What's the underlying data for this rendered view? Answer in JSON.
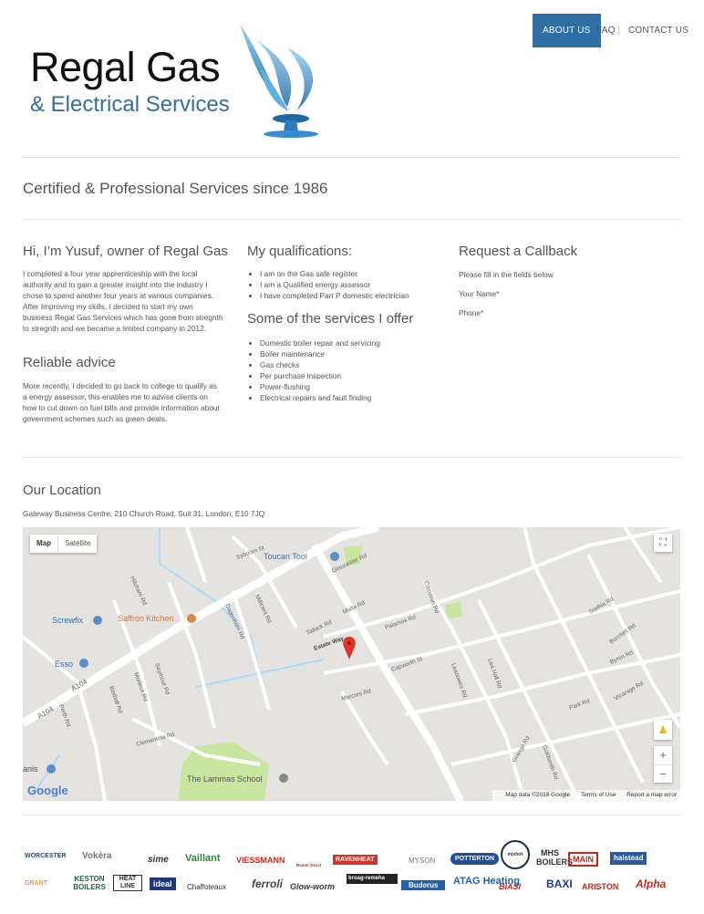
{
  "nav": {
    "about": "ABOUT US",
    "faq": "FAQ",
    "contact": "CONTACT US"
  },
  "logo": {
    "title": "Regal Gas",
    "subtitle": "& Electrical Services"
  },
  "tagline": "Certified & Professional Services since 1986",
  "intro": {
    "heading": "Hi, I’m Yusuf, owner of Regal Gas",
    "text": "I completed a four year apprenticeship with the local authority and to gain a greater insight into the industry I chose to spend another four years at various companies. After Improving my skills, I decided to start my own business Regal Gas Services which has gone from stregnth to stregnth and we became a limited company in 2012."
  },
  "advice": {
    "heading": "Reliable advice",
    "text": "More recently, I decided to go back to college to qualify as a energy assessor, this enables me to advise clients on how to cut down on fuel bills and provide information about government schemes such as green deals."
  },
  "qualifications": {
    "heading": "My qualifications:",
    "items": [
      "I am on the Gas safe register",
      "I am a Qualified energy assessor",
      "I have completed Part P domestic electrician"
    ]
  },
  "services": {
    "heading": "Some of the services I offer",
    "items": [
      "Domestic boiler repair and servicing",
      "Boiler maintenance",
      "Gas checks",
      "Per purchase inspection",
      "Power-flushing",
      "Electrical repairs and fault finding"
    ]
  },
  "callback": {
    "heading": "Request a Callback",
    "note": "Please fill in the fields below",
    "name_label": "Your Name*",
    "phone_label": "Phone*"
  },
  "location": {
    "heading": "Our Location",
    "address": "Gateway Business Centre, 210 Church Road, Suit 31, London, E10 7JQ"
  },
  "map": {
    "type_map": "Map",
    "type_satellite": "Satellite",
    "zoom_in": "+",
    "zoom_out": "−",
    "google": "Google",
    "attribution": "Map data ©2018 Google",
    "terms": "Terms of Use",
    "report": "Report a map error",
    "places": {
      "toucan": "Toucan Tool",
      "screwfix": "Screwfix",
      "saffron": "Saffron Kitchen",
      "esso": "Esso",
      "lammas": "The Lammas School",
      "anis": "anis"
    },
    "roads": {
      "a104a": "A104",
      "a104b": "A104",
      "estate": "Estate Way",
      "tallack": "Tallack Rd",
      "palamos": "Palamos Rd",
      "capworth": "Capworth St",
      "malta": "Malta Rd",
      "gloucester": "Gloucester Rd",
      "sybourn": "Sybourn St",
      "marconi": "Marconi Rd",
      "leasowes": "Leasowes Rd",
      "lea_hall": "Lea Hall Rd",
      "park": "Park Rd",
      "vicarage": "Vicarage Rd",
      "burchell": "Burchell Rd",
      "byron": "Byron Rd",
      "sophia": "Sophia Rd",
      "clementina": "Clementina Rd",
      "seymour": "Seymour Rd",
      "morieux": "Morieux Rd",
      "bisthall": "Bisthall Rd",
      "perth": "Perth Rd",
      "millicent": "Millicent Rd",
      "dagenham": "Dagenham Rd",
      "hitcham": "Hitcham Rd",
      "goldsmith": "Goldsmith Rd",
      "grange": "Grange Rd",
      "cameron": "Cameron Rd"
    }
  },
  "brands": [
    "WORCESTER",
    "Vokèra",
    "sime",
    "Vaillant",
    "VIESSMANN",
    "Baxter Dezal",
    "RAVENHEAT",
    "MYSON",
    "POTTERTON",
    "mixfort",
    "MHS BOILERS",
    "MAIN",
    "halstead",
    "GRANT",
    "KESTON BOILERS",
    "HEAT LINE",
    "ideal",
    "Chaffoteaux",
    "ferroli",
    "Glow-worm",
    "broag-remeha",
    "Buderus",
    "ATAG Heating",
    "BIASI",
    "BAXI",
    "ARISTON",
    "Alpha"
  ],
  "colors": {
    "accent": "#2f6fa6",
    "map_bg": "#e5e3df",
    "park": "#c8e6a0",
    "road": "#ffffff"
  }
}
